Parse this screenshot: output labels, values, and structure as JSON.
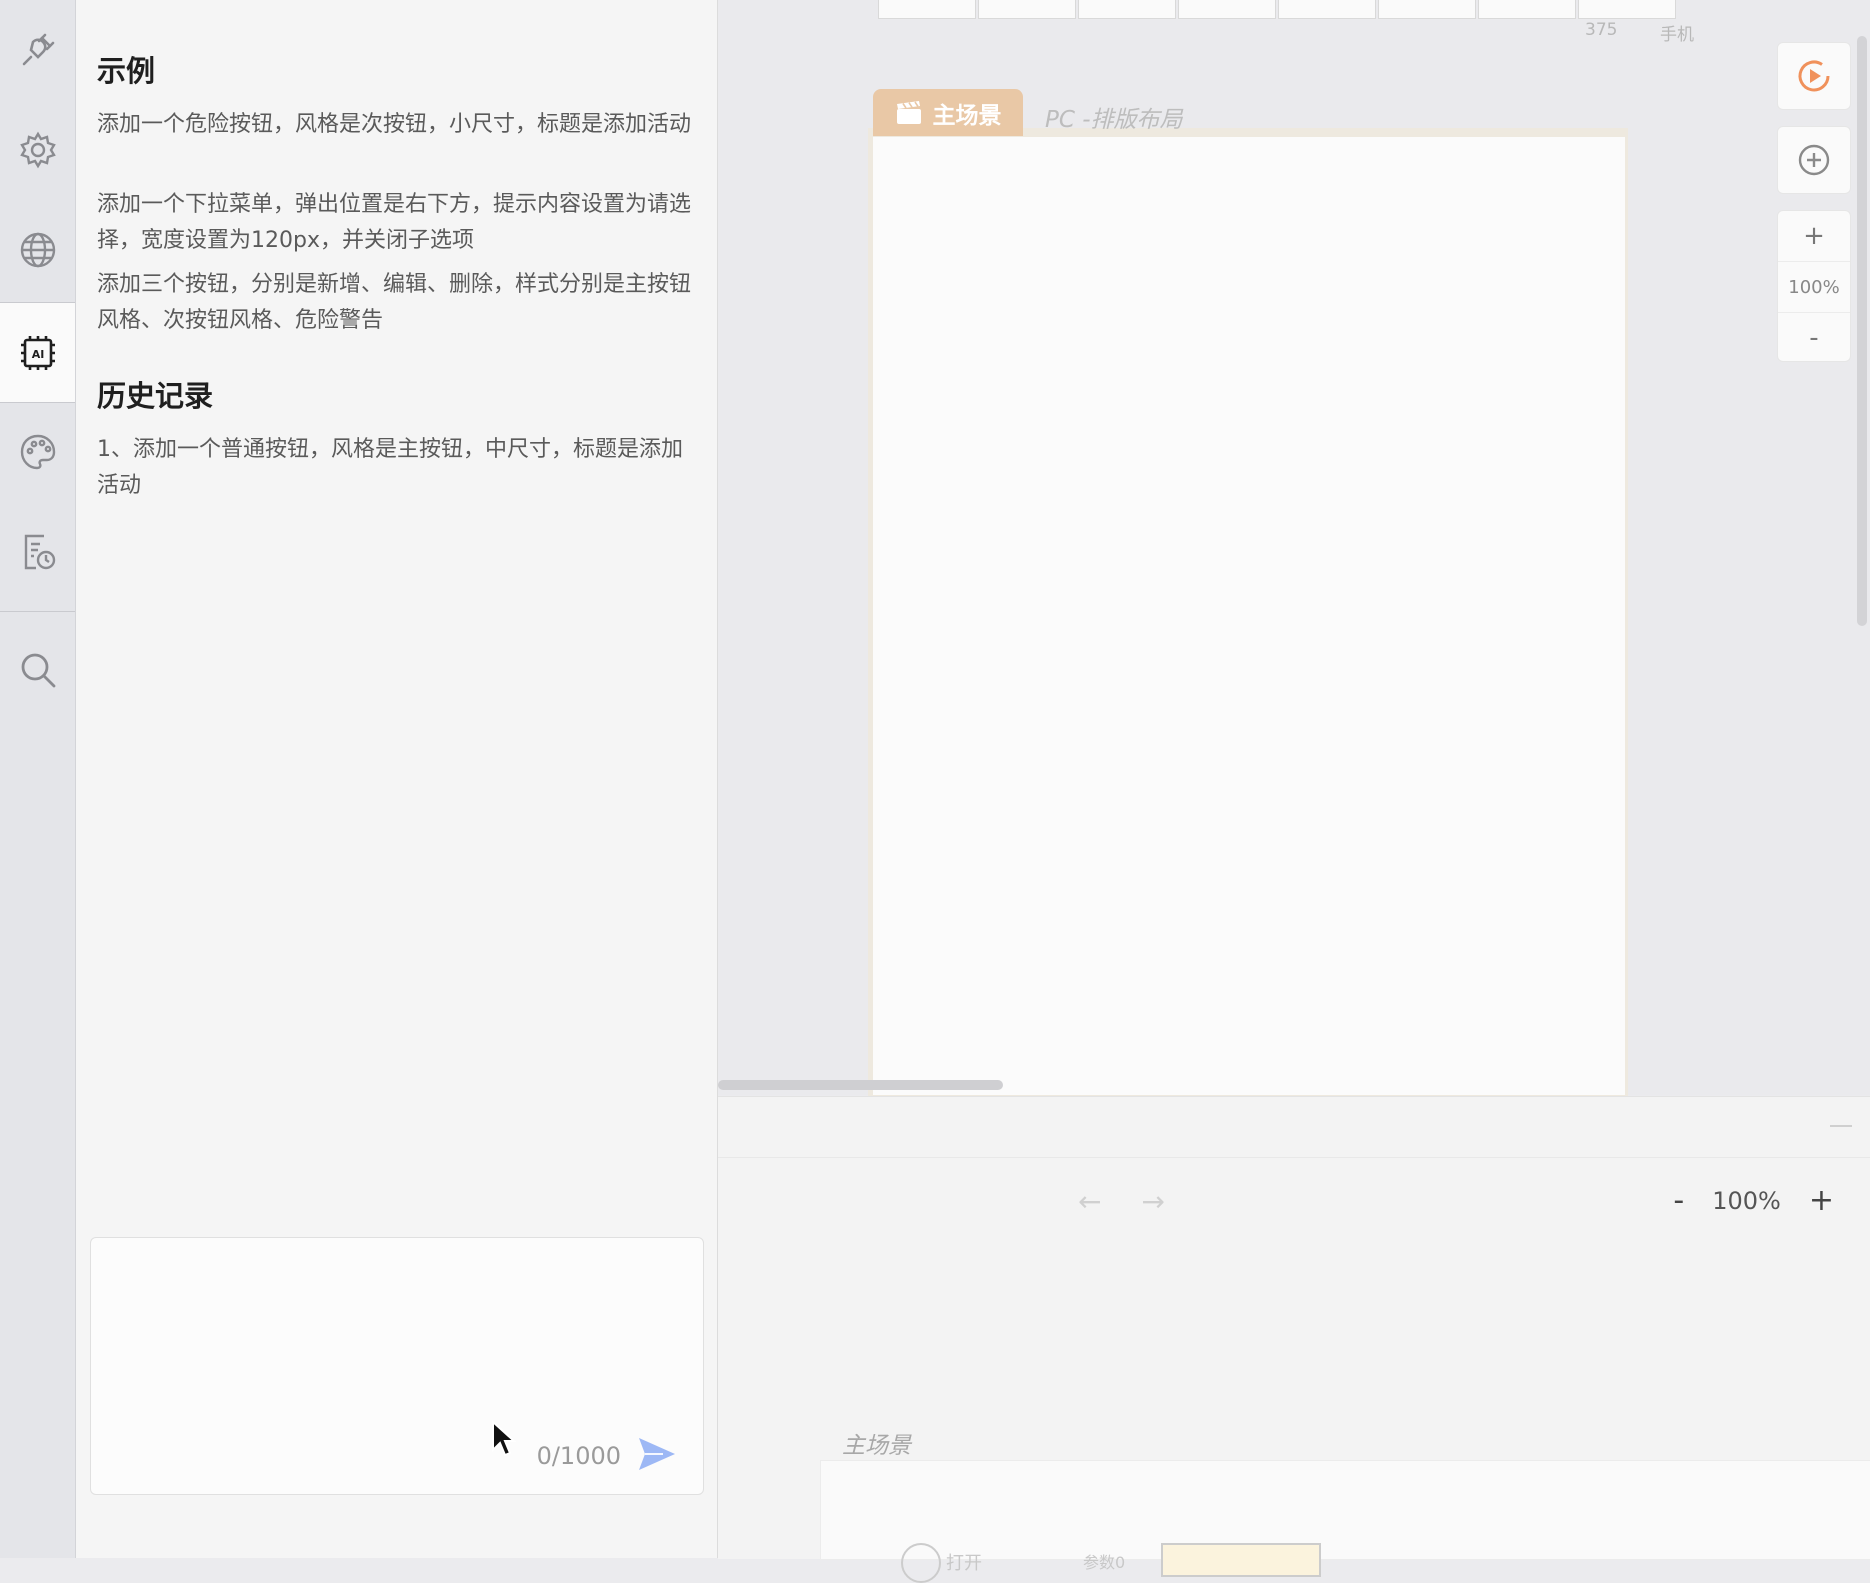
{
  "rail": {
    "items": [
      {
        "name": "plugin",
        "icon": "plug-icon",
        "active": false
      },
      {
        "name": "settings",
        "icon": "gear-icon",
        "active": false
      },
      {
        "name": "globe",
        "icon": "globe-icon",
        "active": false
      },
      {
        "name": "ai",
        "icon": "ai-chip-icon",
        "active": true,
        "label": "AI"
      },
      {
        "name": "theme",
        "icon": "palette-icon",
        "active": false
      },
      {
        "name": "history",
        "icon": "clipboard-clock-icon",
        "active": false
      },
      {
        "name": "search",
        "icon": "search-icon",
        "active": false
      }
    ]
  },
  "ai_panel": {
    "examples_title": "示例",
    "examples": [
      "添加一个危险按钮，风格是次按钮，小尺寸，标题是添加活动",
      "添加一个下拉菜单，弹出位置是右下方，提示内容设置为请选择，宽度设置为120px，并关闭子选项",
      "添加三个按钮，分别是新增、编辑、删除，样式分别是主按钮风格、次按钮风格、危险警告"
    ],
    "history_title": "历史记录",
    "history": [
      "1、添加一个普通按钮，风格是主按钮，中尺寸，标题是添加活动"
    ],
    "input": {
      "value": "",
      "counter": "0/1000"
    }
  },
  "canvas": {
    "ruler_labels": [
      "375",
      "手机"
    ],
    "scene_tab_label": "主场景",
    "layout_label": "PC -排版布局",
    "zoom_value": "100%",
    "zoom_in": "+",
    "zoom_out": "-"
  },
  "logic_panel": {
    "nav_back": "←",
    "nav_forward": "→",
    "zoom_out": "-",
    "zoom_value": "100%",
    "zoom_in": "+",
    "scene_label": "主场景",
    "node_text": "打开",
    "param_text": "参数0"
  },
  "colors": {
    "accent_orange": "#f0915b",
    "scene_tab": "#e9c8a6",
    "send_icon": "#9db8f5"
  }
}
